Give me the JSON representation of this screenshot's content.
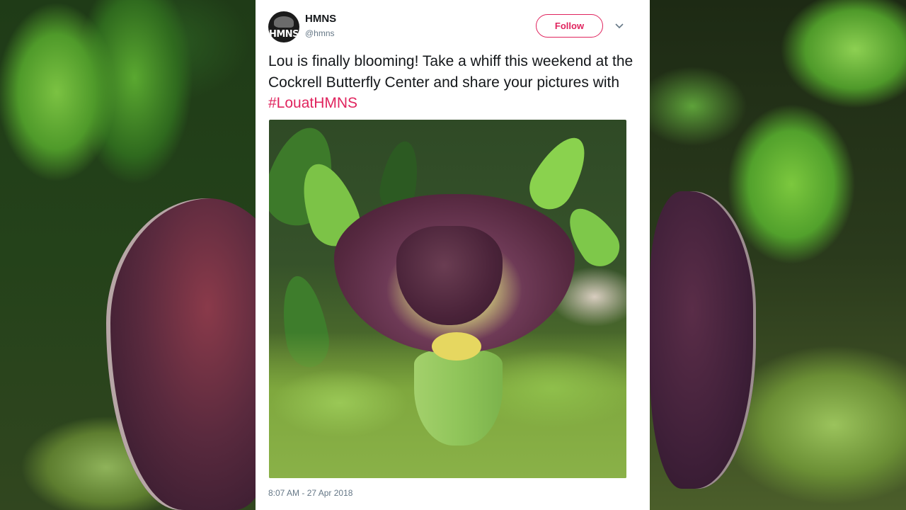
{
  "tweet": {
    "avatar_text": "HMNS",
    "display_name": "HMNS",
    "handle": "@hmns",
    "follow_label": "Follow",
    "text_main": "Lou is finally blooming! Take a whiff this weekend at the Cockrell Butterfly Center and share your pictures with ",
    "hashtag": "#LouatHMNS",
    "timestamp": "8:07 AM - 27 Apr 2018"
  },
  "icons": {
    "caret": "chevron-down-icon"
  },
  "colors": {
    "accent": "#e0245e",
    "text": "#14171a",
    "muted": "#657786"
  }
}
